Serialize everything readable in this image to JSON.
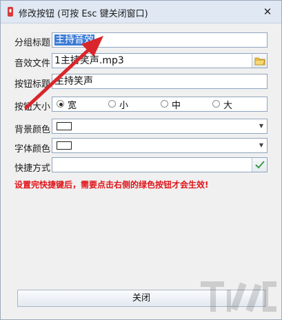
{
  "window": {
    "title": "修改按钮 (可按 Esc 键关闭窗口)",
    "close_glyph": "✕"
  },
  "form": {
    "group_title_label": "分组标题",
    "group_title_value": "主持音效",
    "sound_file_label": "音效文件",
    "sound_file_value": "1主持笑声.mp3",
    "button_title_label": "按钮标题",
    "button_title_value": "主持笑声",
    "button_size_label": "按钮大小",
    "size_options": [
      {
        "label": "宽",
        "checked": true
      },
      {
        "label": "小",
        "checked": false
      },
      {
        "label": "中",
        "checked": false
      },
      {
        "label": "大",
        "checked": false
      }
    ],
    "bg_color_label": "背景颜色",
    "font_color_label": "字体颜色",
    "shortcut_label": "快捷方式",
    "shortcut_value": ""
  },
  "hint_text": "设置完快捷键后，需要点击右侧的绿色按钮才会生效!",
  "close_button_label": "关闭",
  "colors": {
    "accent": "#3a7bd5",
    "hint": "#e0141a",
    "arrow": "#d9262b",
    "check": "#3b9a4a"
  }
}
